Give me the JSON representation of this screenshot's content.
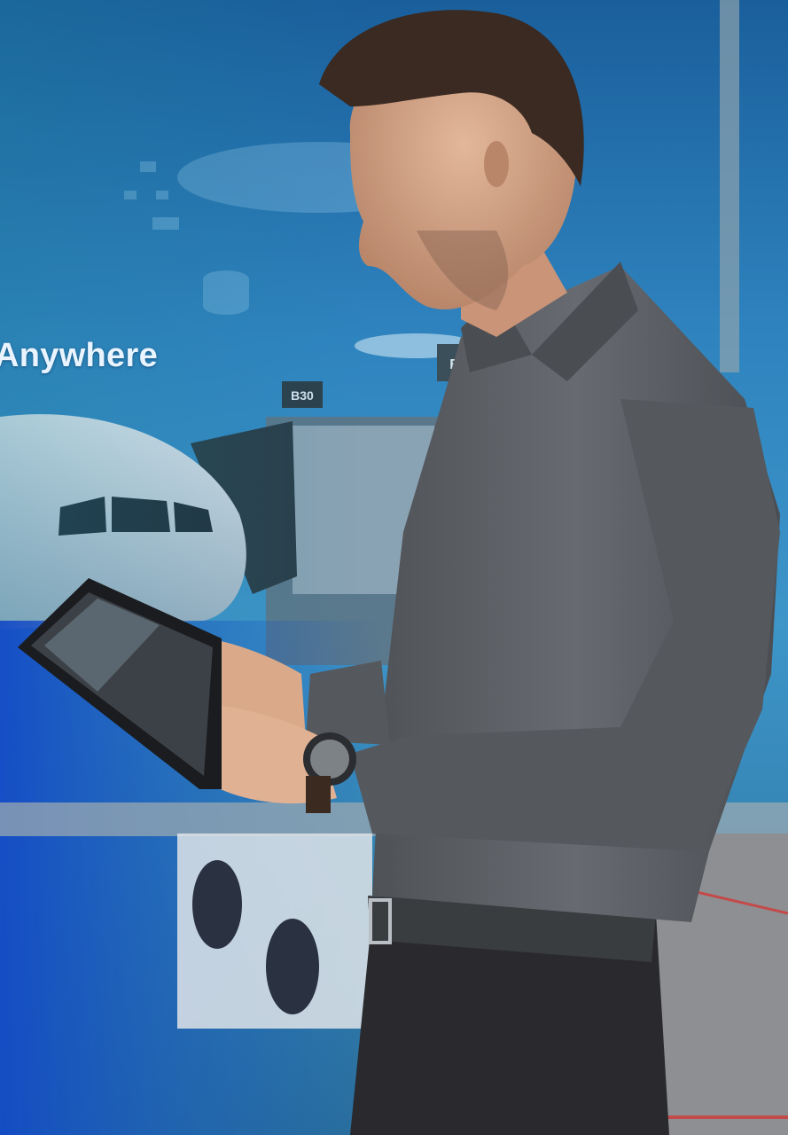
{
  "hero": {
    "headline": "Anywhere",
    "gate_sign_1": "B30",
    "gate_sign_2": "B",
    "illustration": "businessman-using-tablet-at-airport-gate"
  },
  "colors": {
    "sky_top": "#1f6fae",
    "sky_mid": "#3f93c8",
    "overlay_blue": "#1d4fd0",
    "headline": "#e9f4ff",
    "shirt": "#5b5e63",
    "pants": "#2a2a2e"
  }
}
